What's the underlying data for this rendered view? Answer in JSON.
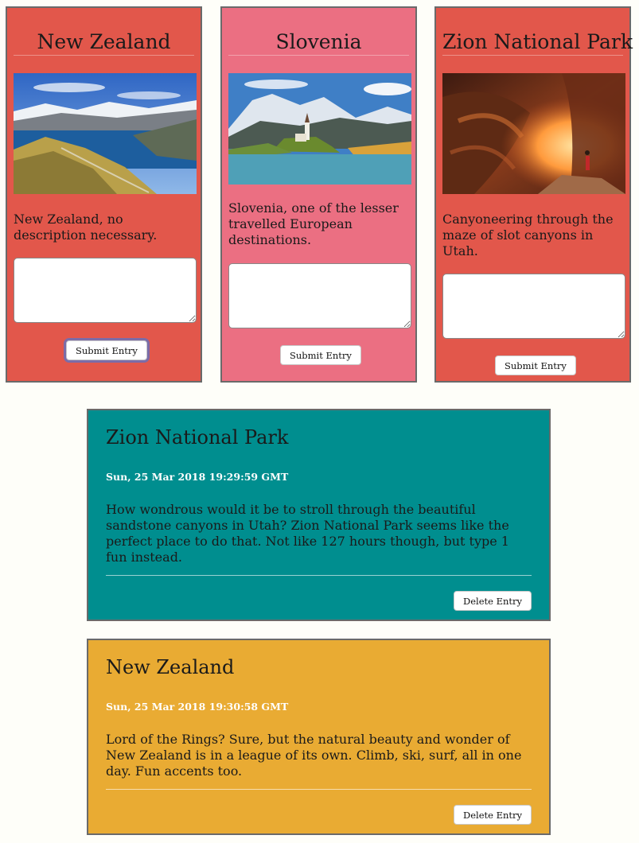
{
  "colors": {
    "page_background": "#fefef9",
    "card_red": "#e2574b",
    "card_pink": "#eb6f82",
    "entry_teal": "#008e8f",
    "entry_gold": "#e9ab33"
  },
  "cards": [
    {
      "title": "New Zealand",
      "image_icon": "mountain-lake-photo",
      "description": "New Zealand, no description necessary.",
      "textarea_value": "",
      "submit_label": "Submit Entry"
    },
    {
      "title": "Slovenia",
      "image_icon": "lake-island-church-photo",
      "description": "Slovenia, one of the lesser travelled European destinations.",
      "textarea_value": "",
      "submit_label": "Submit Entry"
    },
    {
      "title": "Zion National Park",
      "image_icon": "slot-canyon-photo",
      "description": "Canyoneering through the maze of slot canyons in Utah.",
      "textarea_value": "",
      "submit_label": "Submit Entry"
    }
  ],
  "entries": [
    {
      "title": "Zion National Park",
      "date": "Sun, 25 Mar 2018 19:29:59 GMT",
      "body": "How wondrous would it be to stroll through the beautiful sandstone canyons in Utah? Zion National Park seems like the perfect place to do that. Not like 127 hours though, but type 1 fun instead.",
      "delete_label": "Delete Entry"
    },
    {
      "title": "New Zealand",
      "date": "Sun, 25 Mar 2018 19:30:58 GMT",
      "body": "Lord of the Rings? Sure, but the natural beauty and wonder of New Zealand is in a league of its own. Climb, ski, surf, all in one day. Fun accents too.",
      "delete_label": "Delete Entry"
    }
  ]
}
